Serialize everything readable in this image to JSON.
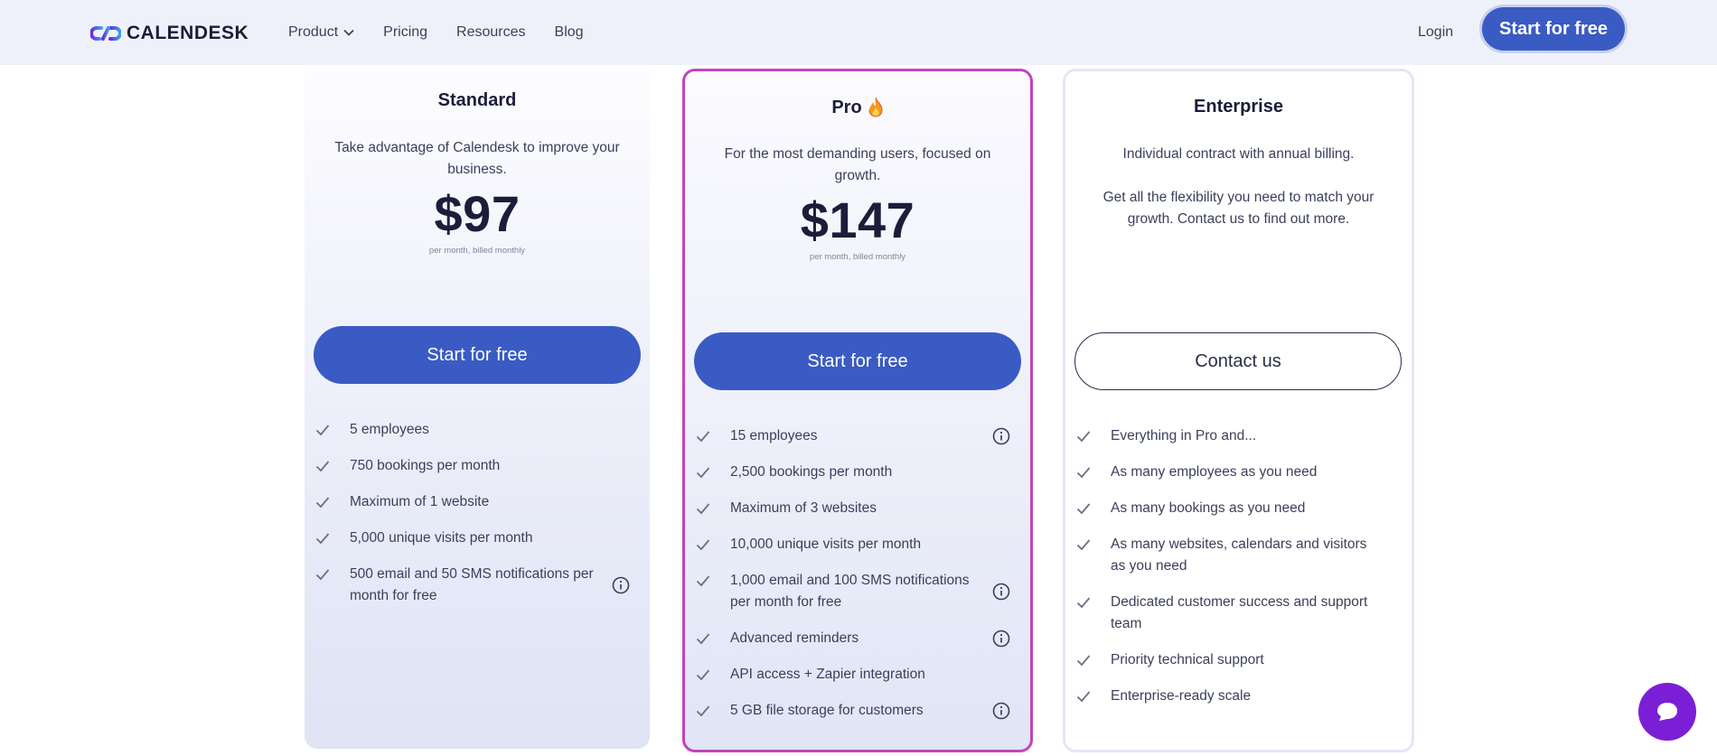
{
  "header": {
    "brand": "CALENDESK",
    "nav": [
      {
        "label": "Product",
        "dropdown": true
      },
      {
        "label": "Pricing"
      },
      {
        "label": "Resources"
      },
      {
        "label": "Blog"
      }
    ],
    "login": "Login",
    "cta": "Start for free"
  },
  "colors": {
    "primary": "#3a5bc4",
    "pro_border": "#c243bf",
    "chat": "#7b1fd6"
  },
  "plans": {
    "standard": {
      "title": "Standard",
      "description": "Take advantage of Calendesk to improve your business.",
      "price": "$97",
      "price_note": "per month, billed monthly",
      "button": "Start for free",
      "features": [
        {
          "text": "5 employees",
          "info": false
        },
        {
          "text": "750 bookings per month",
          "info": false
        },
        {
          "text": "Maximum of 1 website",
          "info": false
        },
        {
          "text": "5,000 unique visits per month",
          "info": false
        },
        {
          "text": "500 email and 50 SMS notifications per month for free",
          "info": true
        }
      ]
    },
    "pro": {
      "title": "Pro",
      "badge_icon": "fire-icon",
      "description": "For the most demanding users, focused on growth.",
      "price": "$147",
      "price_note": "per month, billed monthly",
      "button": "Start for free",
      "features": [
        {
          "text": "15 employees",
          "info": true
        },
        {
          "text": "2,500 bookings per month",
          "info": false
        },
        {
          "text": "Maximum of 3 websites",
          "info": false
        },
        {
          "text": "10,000 unique visits per month",
          "info": false
        },
        {
          "text": "1,000 email and 100 SMS notifications per month for free",
          "info": true
        },
        {
          "text": "Advanced reminders",
          "info": true
        },
        {
          "text": "API access + Zapier integration",
          "info": false
        },
        {
          "text": "5 GB file storage for customers",
          "info": true
        }
      ]
    },
    "enterprise": {
      "title": "Enterprise",
      "description_1": "Individual contract with annual billing.",
      "description_2": "Get all the flexibility you need to match your growth. Contact us to find out more.",
      "button": "Contact us",
      "features": [
        {
          "text": "Everything in Pro and...",
          "info": false
        },
        {
          "text": "As many employees as you need",
          "info": false
        },
        {
          "text": "As many bookings as you need",
          "info": false
        },
        {
          "text": "As many websites, calendars and visitors as you need",
          "info": false
        },
        {
          "text": "Dedicated customer success and support team",
          "info": false
        },
        {
          "text": "Priority technical support",
          "info": false
        },
        {
          "text": "Enterprise-ready scale",
          "info": false
        }
      ]
    }
  }
}
